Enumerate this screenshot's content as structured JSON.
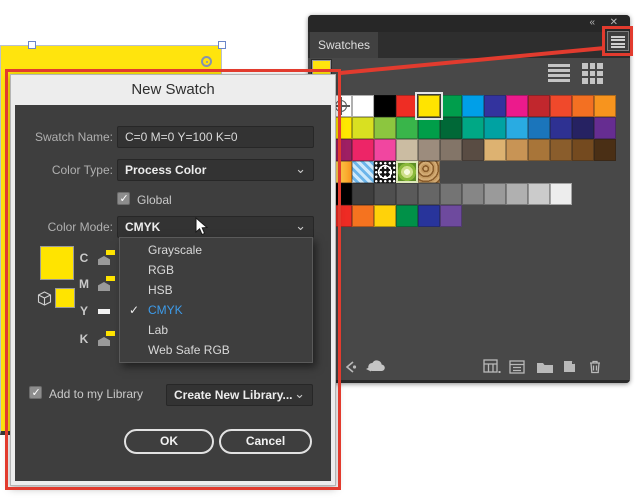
{
  "glyphs": {
    "chevron_down": "⌄",
    "collapse": "«",
    "close": "✕"
  },
  "annotation_color": "#e23b2e",
  "artboard_object": {
    "fill_color": "#ffe40d"
  },
  "dialog": {
    "title": "New Swatch",
    "fields": {
      "swatch_name": {
        "label": "Swatch Name:",
        "value": "C=0 M=0 Y=100 K=0"
      },
      "color_type": {
        "label": "Color Type:",
        "value": "Process Color"
      },
      "global": {
        "label": "Global",
        "checked": true
      },
      "color_mode": {
        "label": "Color Mode:",
        "value": "CMYK"
      }
    },
    "color_mode_menu": {
      "items": [
        {
          "label": "Grayscale"
        },
        {
          "label": "RGB"
        },
        {
          "label": "HSB"
        },
        {
          "label": "CMYK",
          "selected": true
        },
        {
          "label": "Lab"
        },
        {
          "label": "Web Safe RGB"
        }
      ]
    },
    "channels": [
      "C",
      "M",
      "Y",
      "K"
    ],
    "preview_color": "#ffe400",
    "library": {
      "label": "Add to my Library",
      "checked": true,
      "value": "Create New Library..."
    },
    "buttons": {
      "ok": "OK",
      "cancel": "Cancel"
    }
  },
  "panel": {
    "tab": "Swatches",
    "fill_proxy_color": "#ffe40d",
    "view_icons": [
      "list-view",
      "grid-view"
    ],
    "swatch_rows": [
      [
        "@registration",
        "#ffffff",
        "#000000",
        "#ee2d24",
        "!#ffe400",
        "#009e4c",
        "#009fe8",
        "#33339e",
        "#ec1a8c",
        "#c1272d",
        "#f0492b",
        "#f37022",
        "#f7941e"
      ],
      [
        "#ffe800",
        "#d9e021",
        "#8cc63f",
        "#39b54a",
        "#009e49",
        "#006837",
        "#00a885",
        "#00a2a2",
        "#29abe2",
        "#1b75bb",
        "#2e3192",
        "#262262",
        "#662d91"
      ],
      [
        "#9e1f63",
        "#ed2567",
        "#f146a0",
        "#cbbca2",
        "#9c8c7d",
        "#837568",
        "#594c43",
        "#ddb271",
        "#c89455",
        "#a87539",
        "#8a5d2c",
        "#744a1f",
        "#4a2f15"
      ],
      [
        "@grad-orange",
        "@pat-blue",
        "@pat-dots",
        "@pat-green",
        "@pat-swirl"
      ],
      [
        "#000000",
        "#3f3f3f",
        "#4f4f4f",
        "#5a5a5a",
        "#666666",
        "#747474",
        "#868686",
        "#9a9a9a",
        "#b0b0b0",
        "#cbcbcb",
        "#ededed"
      ],
      [
        "#ee2b24",
        "#f5731f",
        "#ffd20a",
        "#009148",
        "#28349b",
        "#6e4a9e"
      ]
    ],
    "bottom_icons": [
      "libraries",
      "sync-cloud",
      "swatch-libraries-menu",
      "show-swatch-kinds",
      "new-color-group",
      "new-swatch",
      "delete-swatch"
    ]
  }
}
